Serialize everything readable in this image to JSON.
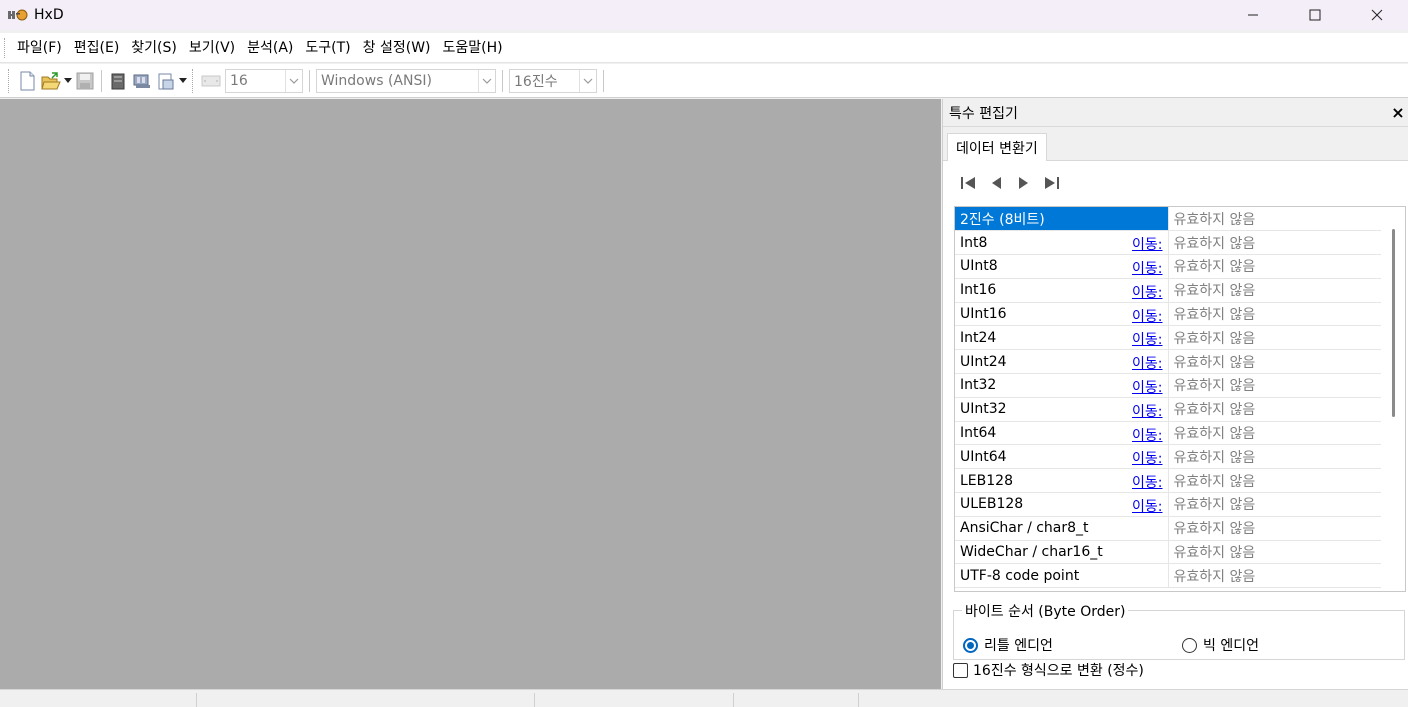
{
  "window": {
    "title": "HxD"
  },
  "menu": [
    {
      "label": "파일(F)"
    },
    {
      "label": "편집(E)"
    },
    {
      "label": "찾기(S)"
    },
    {
      "label": "보기(V)"
    },
    {
      "label": "분석(A)"
    },
    {
      "label": "도구(T)"
    },
    {
      "label": "창 설정(W)"
    },
    {
      "label": "도움말(H)"
    }
  ],
  "toolbar": {
    "bytes_per_row": "16",
    "charset": "Windows (ANSI)",
    "offset_base": "16진수"
  },
  "panel": {
    "title": "특수 편집기",
    "close_glyph": "×",
    "tab_label": "데이터 변환기",
    "goto_label": "이동:",
    "rows": [
      {
        "name": "2진수 (8비트)",
        "value": "유효하지 않음",
        "goto": false,
        "selected": true
      },
      {
        "name": "Int8",
        "value": "유효하지 않음",
        "goto": true
      },
      {
        "name": "UInt8",
        "value": "유효하지 않음",
        "goto": true
      },
      {
        "name": "Int16",
        "value": "유효하지 않음",
        "goto": true
      },
      {
        "name": "UInt16",
        "value": "유효하지 않음",
        "goto": true
      },
      {
        "name": "Int24",
        "value": "유효하지 않음",
        "goto": true
      },
      {
        "name": "UInt24",
        "value": "유효하지 않음",
        "goto": true
      },
      {
        "name": "Int32",
        "value": "유효하지 않음",
        "goto": true
      },
      {
        "name": "UInt32",
        "value": "유효하지 않음",
        "goto": true
      },
      {
        "name": "Int64",
        "value": "유효하지 않음",
        "goto": true
      },
      {
        "name": "UInt64",
        "value": "유효하지 않음",
        "goto": true
      },
      {
        "name": "LEB128",
        "value": "유효하지 않음",
        "goto": true
      },
      {
        "name": "ULEB128",
        "value": "유효하지 않음",
        "goto": true
      },
      {
        "name": "AnsiChar / char8_t",
        "value": "유효하지 않음",
        "goto": false
      },
      {
        "name": "WideChar / char16_t",
        "value": "유효하지 않음",
        "goto": false
      },
      {
        "name": "UTF-8 code point",
        "value": "유효하지 않음",
        "goto": false
      }
    ],
    "byte_order": {
      "legend": "바이트 순서 (Byte Order)",
      "little_endian": "리틀 엔디언",
      "big_endian": "빅 엔디언",
      "selected": "little_endian"
    },
    "hex_checkbox_label": "16진수 형식으로 변환 (정수)",
    "hex_checkbox_checked": false
  },
  "colors": {
    "accent": "#0078d7",
    "workspace": "#ababab",
    "link": "#0000ee"
  }
}
